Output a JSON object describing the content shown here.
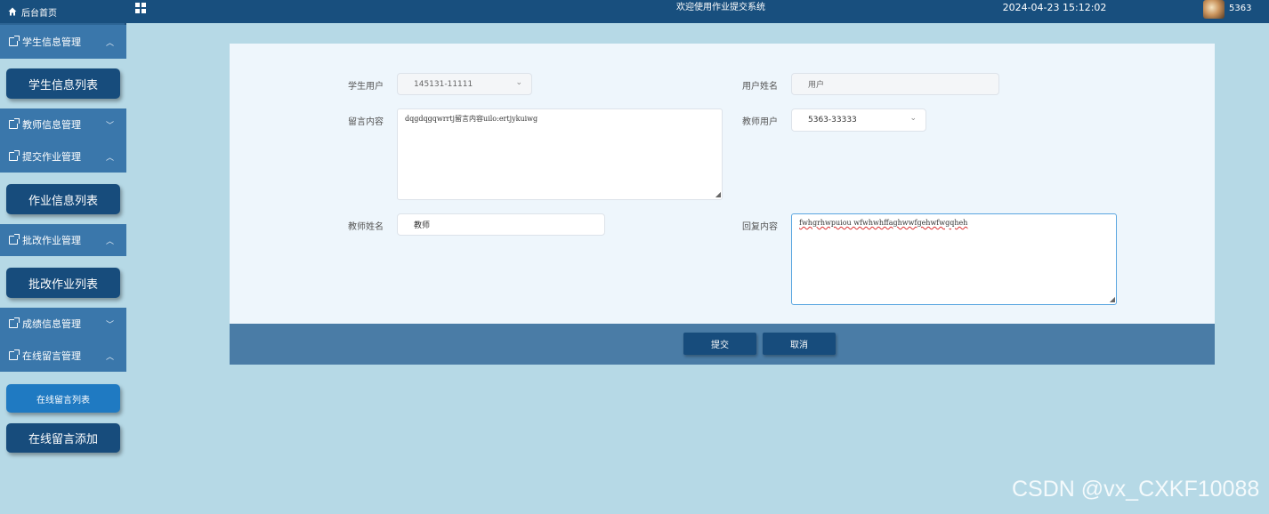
{
  "topbar": {
    "home_label": "后台首页",
    "title": "欢迎使用作业提交系统",
    "datetime": "2024-04-23 15:12:02",
    "username": "5363"
  },
  "sidebar": {
    "groups": [
      {
        "label": "学生信息管理",
        "arrow": "^",
        "items": [
          "学生信息列表"
        ]
      },
      {
        "label": "教师信息管理",
        "arrow": "v"
      },
      {
        "label": "提交作业管理",
        "arrow": "^",
        "items": [
          "作业信息列表"
        ]
      },
      {
        "label": "批改作业管理",
        "arrow": "^",
        "items": [
          "批改作业列表"
        ]
      },
      {
        "label": "成绩信息管理",
        "arrow": "v"
      },
      {
        "label": "在线留言管理",
        "arrow": "^",
        "items": [
          "在线留言列表",
          "在线留言添加"
        ]
      }
    ]
  },
  "form": {
    "student_user_label": "学生用户",
    "student_user_value": "145131-11111",
    "user_name_label": "用户姓名",
    "user_name_value": "用户",
    "message_label": "留言内容",
    "message_value": "dqgdqgqwrrtj留言内容uilo:ertjykuiwg",
    "teacher_user_label": "教师用户",
    "teacher_user_value": "5363-33333",
    "teacher_name_label": "教师姓名",
    "teacher_name_value": "教师",
    "reply_label": "回复内容",
    "reply_value": "fwhgrhwpuiou wfwhwhffaghwwfgehwfwgqheh"
  },
  "buttons": {
    "submit": "提交",
    "cancel": "取消"
  },
  "watermark": "CSDN @vx_CXKF10088",
  "colors": {
    "topbar": "#184f7e",
    "sidebar": "#2c6595",
    "sub_button": "#174c7c",
    "active_sub_button": "#1f7ac2",
    "page_bg": "#b6d9e6",
    "card_bg": "#eef6fc",
    "button_bar": "#4a7ca6"
  }
}
